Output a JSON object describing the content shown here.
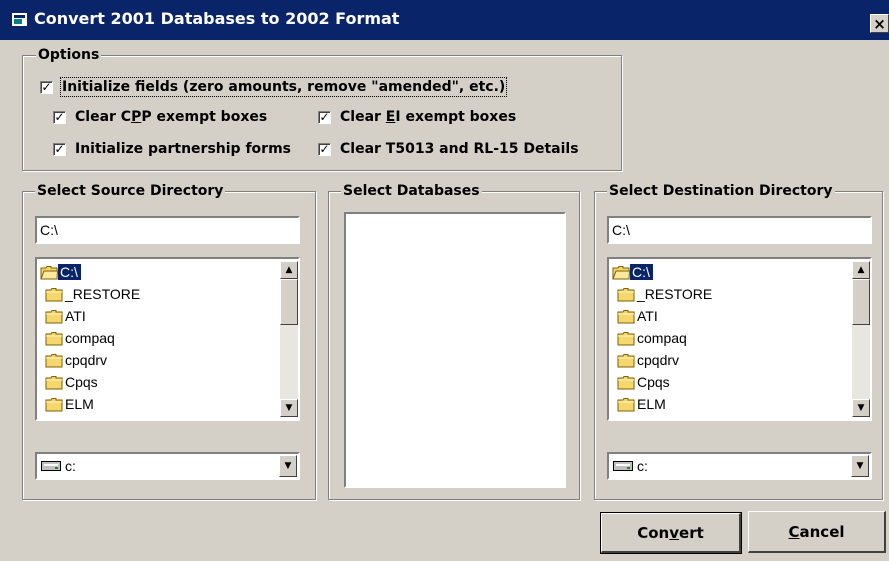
{
  "window": {
    "title": "Convert 2001 Databases to 2002 Format",
    "close_label": "×"
  },
  "options": {
    "legend": "Options",
    "initialize_fields": {
      "label": "Initialize fields (zero amounts, remove \"amended\", etc.)",
      "checked": true
    },
    "clear_cpp": {
      "label_pre": "Clear C",
      "label_key": "P",
      "label_post": "P exempt boxes",
      "checked": true
    },
    "clear_ei": {
      "label_pre": "Clear ",
      "label_key": "E",
      "label_post": "I exempt boxes",
      "checked": true
    },
    "init_partnership": {
      "label": "Initialize partnership forms",
      "checked": true
    },
    "clear_t5013": {
      "label": "Clear T5013 and RL-15 Details",
      "checked": true
    },
    "check_glyph": "✓"
  },
  "source": {
    "legend": "Select Source Directory",
    "path_value": "C:\\",
    "folders": [
      "C:\\",
      "_RESTORE",
      "ATI",
      "compaq",
      "cpqdrv",
      "Cpqs",
      "ELM"
    ],
    "selected_index": 0,
    "drive_value": "c:"
  },
  "databases": {
    "legend": "Select Databases",
    "items": []
  },
  "destination": {
    "legend": "Select Destination Directory",
    "path_value": "C:\\",
    "folders": [
      "C:\\",
      "_RESTORE",
      "ATI",
      "compaq",
      "cpqdrv",
      "Cpqs",
      "ELM"
    ],
    "selected_index": 0,
    "drive_value": "c:"
  },
  "buttons": {
    "convert": {
      "pre": "Con",
      "key": "v",
      "post": "ert"
    },
    "cancel": {
      "pre": "",
      "key": "C",
      "post": "ancel"
    }
  },
  "colors": {
    "titlebar": "#0a246a",
    "face": "#d4d0c8",
    "selection": "#0a246a",
    "folder": "#f5d76e"
  }
}
